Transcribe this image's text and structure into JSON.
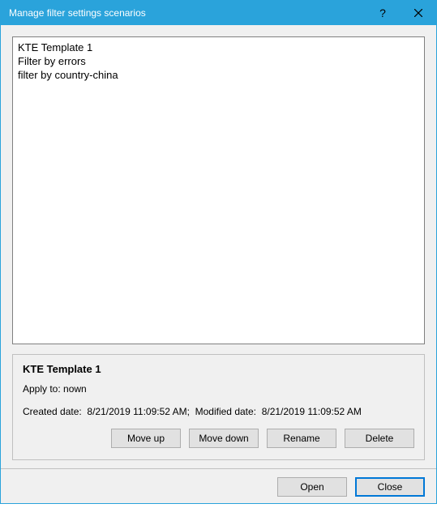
{
  "window": {
    "title": "Manage filter settings scenarios"
  },
  "scenarios": {
    "items": [
      "KTE Template 1",
      "Filter by errors",
      "filter by country-china"
    ]
  },
  "details": {
    "title": "KTE Template 1",
    "apply_to_label": "Apply to:",
    "apply_to_value": "nown",
    "created_label": "Created date:",
    "created_value": "8/21/2019 11:09:52 AM",
    "modified_label": "Modified date:",
    "modified_value": "8/21/2019 11:09:52 AM"
  },
  "buttons": {
    "move_up": "Move up",
    "move_down": "Move down",
    "rename": "Rename",
    "delete": "Delete",
    "open": "Open",
    "close": "Close"
  }
}
